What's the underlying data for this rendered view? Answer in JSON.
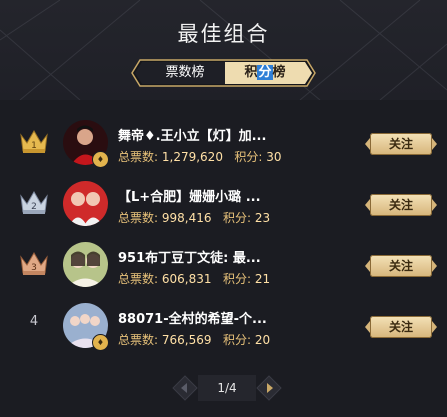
{
  "title": "最佳组合",
  "tabs": [
    {
      "label": "票数榜",
      "active": false
    },
    {
      "label_pre": "积",
      "label_hl": "分",
      "label_post": "榜",
      "active": true
    }
  ],
  "stat_labels": {
    "votes": "总票数:",
    "points": "积分:"
  },
  "follow_label": "关注",
  "rows": [
    {
      "rank": "1",
      "name": "舞帝♦.王小立【灯】加...",
      "votes": "1,279,620",
      "points": "30",
      "badge": "gold-crown"
    },
    {
      "rank": "2",
      "name": "【L+合肥】姗姗小璐 ...",
      "votes": "998,416",
      "points": "23",
      "badge": "silver-crown"
    },
    {
      "rank": "3",
      "name": "951布丁豆丁文徒: 最...",
      "votes": "606,831",
      "points": "21",
      "badge": "bronze-crown"
    },
    {
      "rank": "4",
      "name": "88071-全村的希望-个...",
      "votes": "766,569",
      "points": "20",
      "badge": "none"
    }
  ],
  "pager": {
    "text": "1/4"
  },
  "colors": {
    "gold": "#e2b34d",
    "accent_blue": "#2f7fd6",
    "bg": "#1b1c22"
  }
}
